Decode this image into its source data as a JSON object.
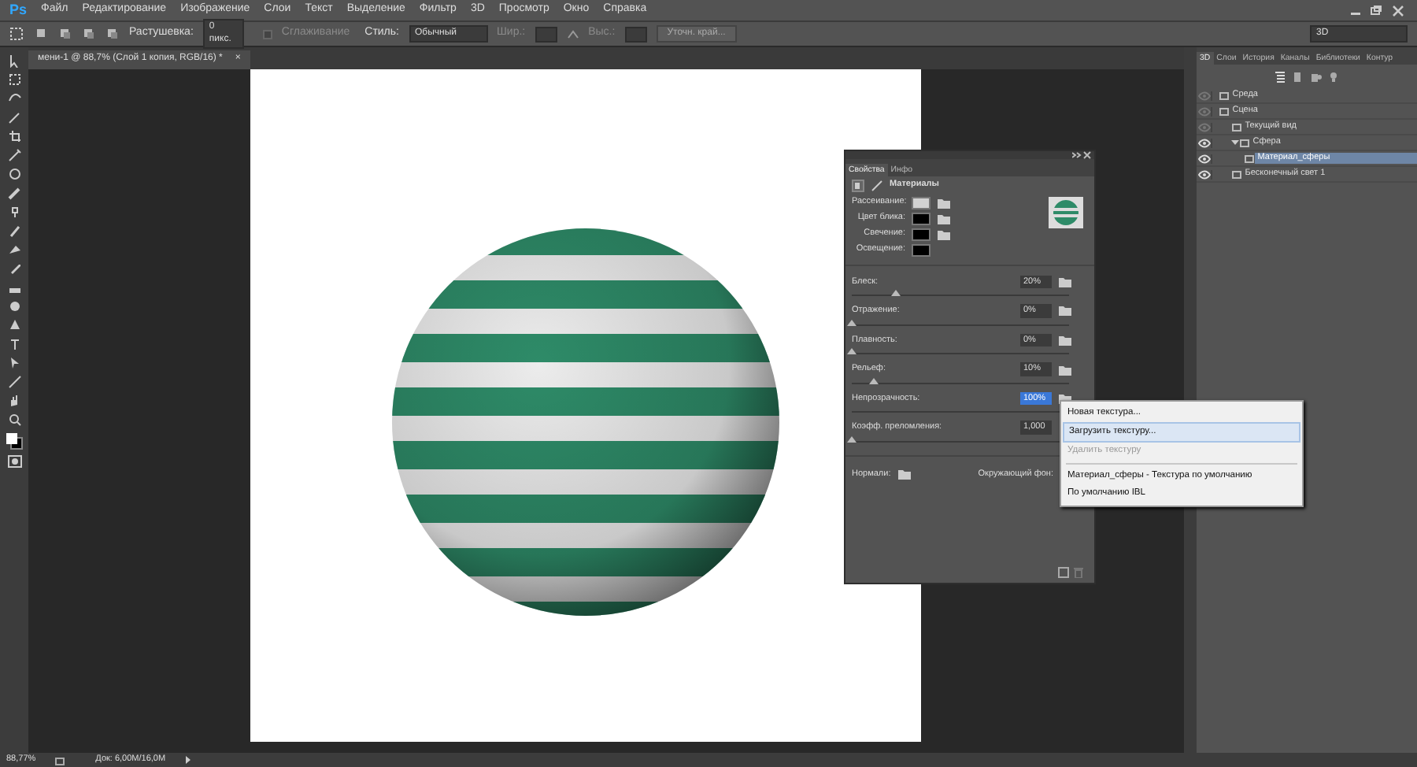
{
  "app": {
    "logo": "Ps"
  },
  "menu": [
    "Файл",
    "Редактирование",
    "Изображение",
    "Слои",
    "Текст",
    "Выделение",
    "Фильтр",
    "3D",
    "Просмотр",
    "Окно",
    "Справка"
  ],
  "options_bar": {
    "feather_label": "Растушевка:",
    "feather_value": "0 пикс.",
    "antialias": {
      "label": "Сглаживание",
      "checked": false,
      "disabled": true
    },
    "style_label": "Стиль:",
    "style_value": "Обычный",
    "width_label": "Шир.:",
    "height_label": "Выс.:",
    "refine_button": "Уточн. край...",
    "workspace": "3D"
  },
  "document_tab": {
    "title": "мени-1 @ 88,7% (Слой 1 копия, RGB/16) *",
    "close": "×"
  },
  "properties": {
    "tabs": [
      {
        "label": "Свойства",
        "selected": true
      },
      {
        "label": "Инфо",
        "selected": false
      }
    ],
    "title": "Материалы",
    "swatches": [
      {
        "label": "Рассеивание:",
        "color": "#d2d2d2"
      },
      {
        "label": "Цвет блика:",
        "color": "#000000"
      },
      {
        "label": "Свечение:",
        "color": "#000000"
      },
      {
        "label": "Освещение:",
        "color": "#000000"
      }
    ],
    "sliders": [
      {
        "kind": "texture",
        "label": "Блеск:",
        "value": "20%",
        "level": 0.2,
        "selected": false
      },
      {
        "kind": "texture",
        "label": "Отражение:",
        "value": "0%",
        "level": 0,
        "selected": false
      },
      {
        "kind": "texture",
        "label": "Плавность:",
        "value": "0%",
        "level": 0,
        "selected": false
      },
      {
        "kind": "texture",
        "label": "Рельеф:",
        "value": "10%",
        "level": 0.1,
        "selected": false
      },
      {
        "kind": "texture",
        "label": "Непрозрачность:",
        "value": "100%",
        "level": 1,
        "selected": true
      },
      {
        "kind": "plain",
        "label": "Коэфф. преломления:",
        "value": "1,000",
        "level": 0,
        "selected": false
      }
    ],
    "normals_label": "Нормали:",
    "environment_label": "Окружающий фон:"
  },
  "context_menu": [
    {
      "kind": "item",
      "label": "Новая текстура...",
      "selected": false,
      "disabled": false
    },
    {
      "kind": "item",
      "label": "Загрузить текстуру...",
      "selected": true,
      "disabled": false
    },
    {
      "kind": "item",
      "label": "Удалить текстуру",
      "selected": false,
      "disabled": true
    },
    {
      "kind": "separator"
    },
    {
      "kind": "item",
      "label": "Материал_сферы - Текстура по умолчанию",
      "selected": false,
      "disabled": false
    },
    {
      "kind": "item",
      "label": "По умолчанию IBL",
      "selected": false,
      "disabled": false
    }
  ],
  "panel_3d": {
    "tabs": [
      {
        "label": "3D",
        "selected": true
      },
      {
        "label": "Слои",
        "selected": false
      },
      {
        "label": "История",
        "selected": false
      },
      {
        "label": "Каналы",
        "selected": false
      },
      {
        "label": "Библиотеки",
        "selected": false
      },
      {
        "label": "Контур",
        "selected": false
      }
    ],
    "tree": [
      {
        "label": "Среда",
        "visible": false,
        "selected": false
      },
      {
        "label": "Сцена",
        "visible": false,
        "selected": false,
        "children": [
          {
            "label": "Текущий вид",
            "visible": false,
            "selected": false
          },
          {
            "label": "Сфера",
            "visible": true,
            "selected": false,
            "expanded": true,
            "children": [
              {
                "label": "Материал_сферы",
                "visible": true,
                "selected": true
              }
            ]
          },
          {
            "label": "Бесконечный свет 1",
            "visible": true,
            "selected": false
          }
        ]
      }
    ]
  },
  "status_bar": {
    "zoom": "88,77%",
    "doc": "Док: 6,00M/16,0M"
  }
}
